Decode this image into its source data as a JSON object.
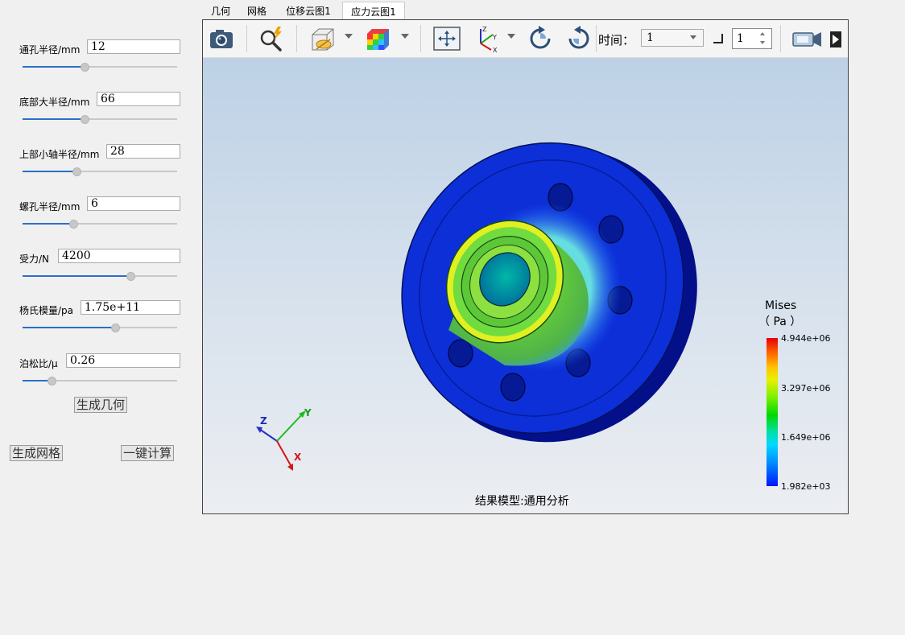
{
  "params": [
    {
      "label": "通孔半径/mm",
      "value": "12",
      "slider": 0.4
    },
    {
      "label": "底部大半径/mm",
      "value": "66",
      "slider": 0.4
    },
    {
      "label": "上部小轴半径/mm",
      "value": "28",
      "slider": 0.35
    },
    {
      "label": "螺孔半径/mm",
      "value": "6",
      "slider": 0.33
    },
    {
      "label": "受力/N",
      "value": "4200",
      "slider": 0.7
    },
    {
      "label": "杨氏模量/pa",
      "value": "1.75e+11",
      "slider": 0.6
    },
    {
      "label": "泊松比/μ",
      "value": "0.26",
      "slider": 0.19
    }
  ],
  "buttons": {
    "generate_geometry": "生成几何",
    "generate_mesh": "生成网格",
    "one_click_compute": "一键计算"
  },
  "tabs": [
    "几何",
    "网格",
    "位移云图1",
    "应力云图1"
  ],
  "active_tab": 3,
  "toolbar": {
    "time_label": "时间：",
    "time_value": "1",
    "step_value": "1",
    "icons": [
      "camera-icon",
      "zoom-icon",
      "clip-plane-icon",
      "color-cube-icon",
      "fit-view-icon",
      "axes-icon",
      "rotate-cw-icon",
      "rotate-ccw-icon",
      "video-camera-icon",
      "play-icon"
    ]
  },
  "view": {
    "legend_title": "Mises",
    "legend_unit": "（ Pa ）",
    "legend_values": [
      "4.944e+06",
      "3.297e+06",
      "1.649e+06",
      "1.982e+03"
    ],
    "caption": "结果模型:通用分析",
    "axes": {
      "x": "X",
      "y": "Y",
      "z": "Z"
    }
  },
  "colors": {
    "accent": "#2a6fc9",
    "flange": "#0c2fd8",
    "stress_high": "#e60000",
    "stress_mid": "#7cf000"
  }
}
